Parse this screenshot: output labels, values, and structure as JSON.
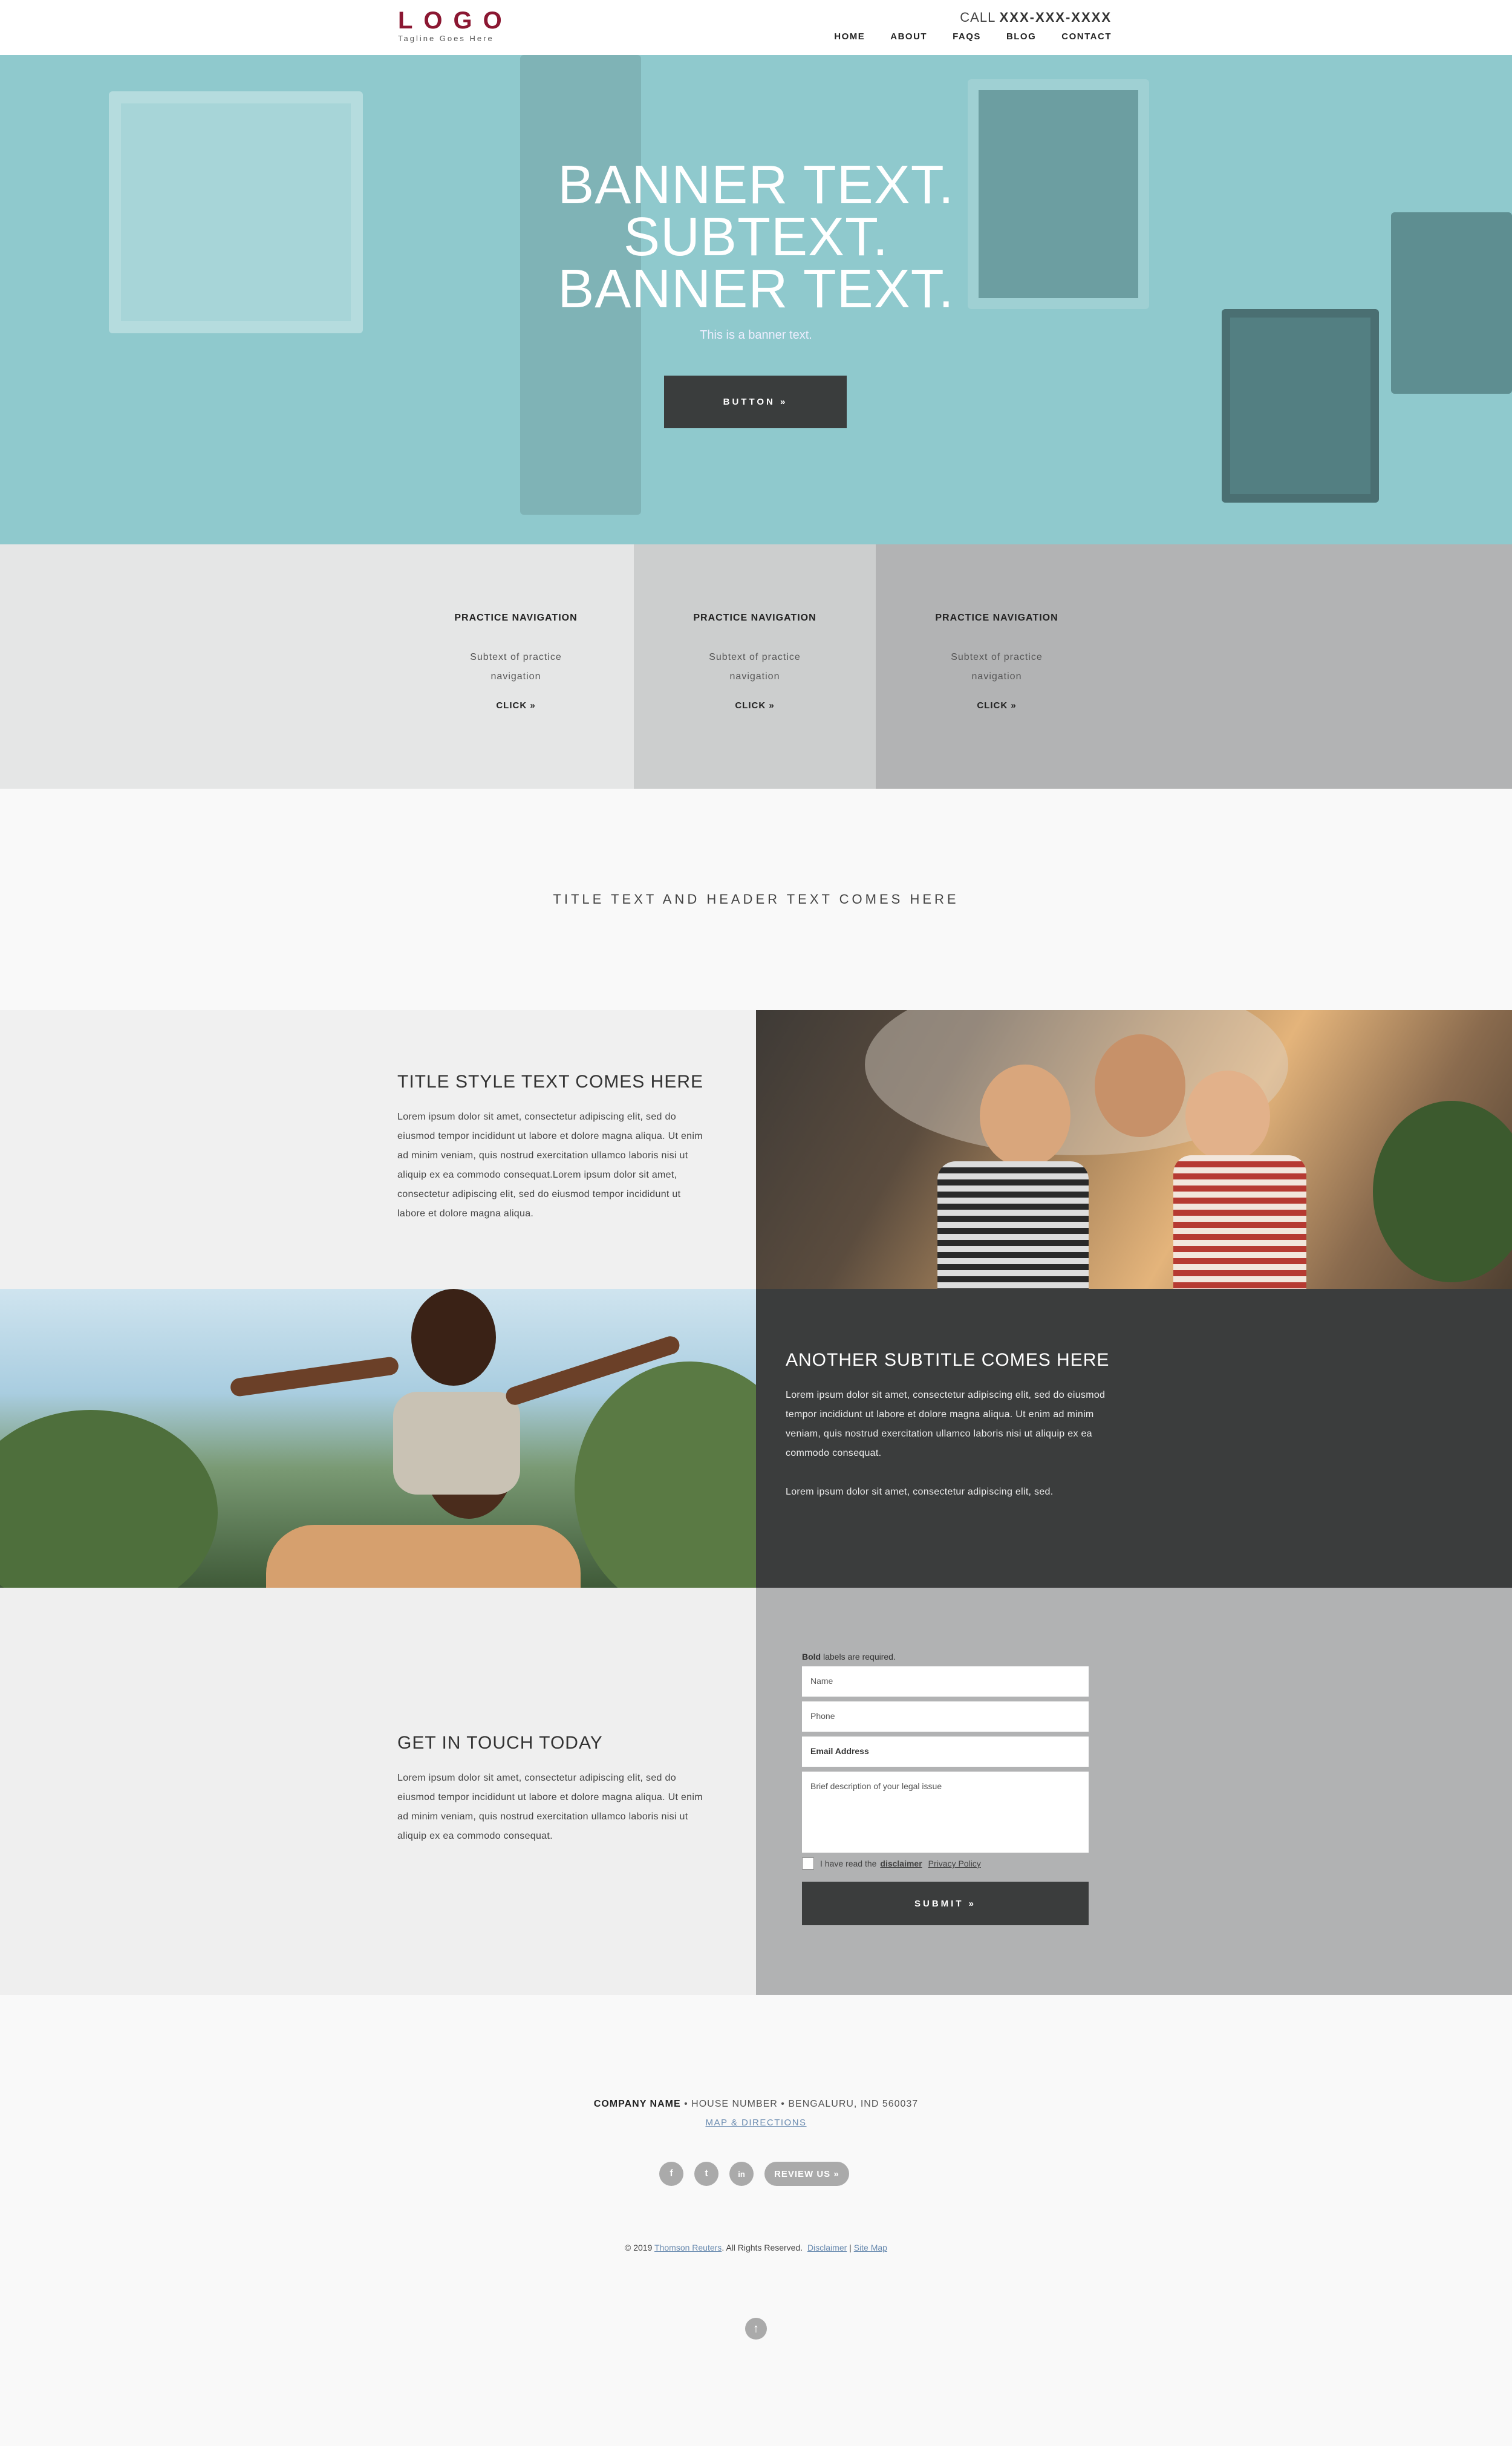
{
  "header": {
    "logo": "LOGO",
    "tagline": "Tagline Goes Here",
    "call_label": "CALL",
    "phone": "XXX-XXX-XXXX",
    "nav": [
      "HOME",
      "ABOUT",
      "FAQS",
      "BLOG",
      "CONTACT"
    ]
  },
  "hero": {
    "line1": "BANNER TEXT.",
    "line2": "SUBTEXT.",
    "line3": "BANNER TEXT.",
    "subtitle": "This is a banner text.",
    "button": "BUTTON »"
  },
  "practice_nav": [
    {
      "title": "PRACTICE NAVIGATION",
      "sub1": "Subtext of practice",
      "sub2": "navigation",
      "cta": "CLICK »",
      "bg": "#e5e6e6"
    },
    {
      "title": "PRACTICE NAVIGATION",
      "sub1": "Subtext of practice",
      "sub2": "navigation",
      "cta": "CLICK »",
      "bg": "#cccece"
    },
    {
      "title": "PRACTICE NAVIGATION",
      "sub1": "Subtext of practice",
      "sub2": "navigation",
      "cta": "CLICK »",
      "bg": "#b2b3b4"
    }
  ],
  "title_section": {
    "text": "TITLE TEXT AND HEADER TEXT COMES HERE"
  },
  "section1": {
    "title": "TITLE STYLE TEXT COMES HERE",
    "body": "Lorem ipsum dolor sit amet, consectetur adipiscing elit, sed do eiusmod tempor incididunt ut labore et dolore magna aliqua. Ut enim ad minim veniam, quis nostrud exercitation ullamco laboris nisi ut aliquip ex ea commodo consequat.Lorem ipsum dolor sit amet, consectetur adipiscing elit, sed do eiusmod tempor incididunt ut labore et dolore magna aliqua."
  },
  "section2": {
    "title": "ANOTHER SUBTITLE COMES HERE",
    "body1": "Lorem ipsum dolor sit amet, consectetur adipiscing elit, sed do eiusmod tempor incididunt ut labore et dolore magna aliqua. Ut enim ad minim veniam, quis nostrud exercitation ullamco laboris nisi ut aliquip ex ea commodo consequat.",
    "body2": "Lorem ipsum dolor sit amet, consectetur adipiscing elit, sed."
  },
  "contact": {
    "title": "GET IN TOUCH TODAY",
    "body": "Lorem ipsum dolor sit amet, consectetur adipiscing elit, sed do eiusmod tempor incididunt ut labore et dolore magna aliqua. Ut enim ad minim veniam, quis nostrud exercitation ullamco laboris nisi ut aliquip ex ea commodo consequat.",
    "form": {
      "note_bold": "Bold",
      "note_rest": " labels are required.",
      "name": "Name",
      "phone": "Phone",
      "email": "Email Address",
      "message": "Brief description of your legal issue",
      "checkbox_text": "I have read the",
      "disclaimer": "disclaimer",
      "privacy": "Privacy Policy",
      "submit": "SUBMIT »"
    }
  },
  "footer": {
    "company": "COMPANY NAME",
    "house": "HOUSE NUMBER",
    "city": "BENGALURU, IND 560037",
    "map": "MAP & DIRECTIONS",
    "social": {
      "facebook": "f",
      "twitter": "t",
      "linkedin": "in"
    },
    "review": "REVIEW US »",
    "copyright": "© 2019",
    "copyright_link": "Thomson Reuters",
    "rights": ". All Rights Reserved.",
    "disclaimer": "Disclaimer",
    "sep": "|",
    "sitemap": "Site Map",
    "totop_icon": "↑"
  },
  "colors": {
    "logo": "#8b1732",
    "hero_bg": "#8fc9cd",
    "dark": "#3b3d3d",
    "link": "#6a8bb0"
  }
}
